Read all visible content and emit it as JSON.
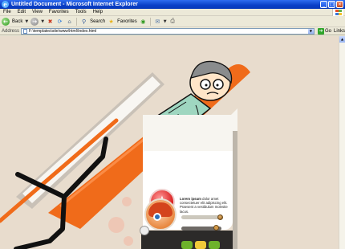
{
  "window": {
    "title": "Untitled Document - Microsoft Internet Explorer",
    "buttons": {
      "minimize": "_",
      "maximize": "□",
      "close": "×"
    }
  },
  "menu": {
    "items": [
      "File",
      "Edit",
      "View",
      "Favorites",
      "Tools",
      "Help"
    ]
  },
  "toolbar": {
    "back_label": "Back",
    "search_label": "Search",
    "favorites_label": "Favorites"
  },
  "address": {
    "label": "Address",
    "value": "F:\\templates\\site\\www\\html\\Index.html",
    "go_label": "Go",
    "links_label": "Links"
  },
  "content": {
    "card_lead": "Lorem ipsum",
    "card_body": " dolor amet consectetuer elit adipiscing elit. Praesent a vestibulum molestie lacus."
  },
  "colors": {
    "accent_orange": "#f06b1a",
    "background": "#e8dccd",
    "dark_panel": "#2c2a29"
  }
}
